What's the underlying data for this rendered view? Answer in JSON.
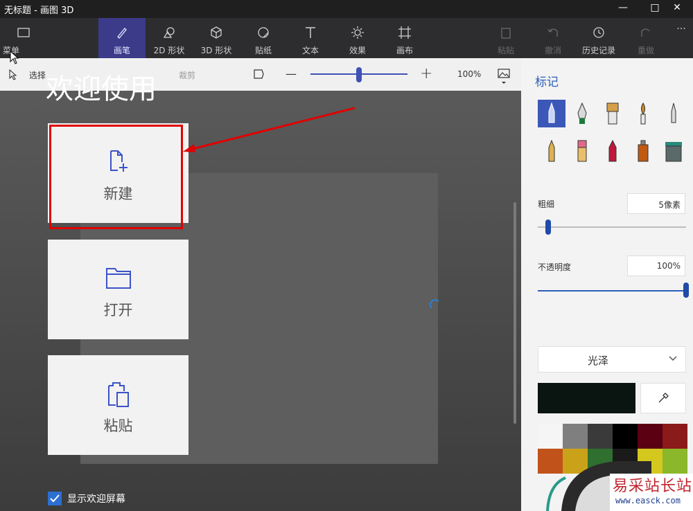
{
  "window": {
    "title": "无标题 - 画图 3D",
    "minimize": "—",
    "maximize": "□",
    "close": "✕"
  },
  "ribbon": {
    "menu": "菜单",
    "tabs": [
      {
        "label": "画笔",
        "icon": "brush-icon",
        "active": true
      },
      {
        "label": "2D 形状",
        "icon": "shapes-2d-icon"
      },
      {
        "label": "3D 形状",
        "icon": "cube-icon"
      },
      {
        "label": "贴纸",
        "icon": "sticker-icon"
      },
      {
        "label": "文本",
        "icon": "text-icon"
      },
      {
        "label": "效果",
        "icon": "effects-icon"
      },
      {
        "label": "画布",
        "icon": "canvas-icon"
      }
    ],
    "actions": [
      {
        "label": "粘贴",
        "icon": "paste-icon",
        "enabled": false
      },
      {
        "label": "撤消",
        "icon": "undo-icon",
        "enabled": false
      },
      {
        "label": "历史记录",
        "icon": "history-icon",
        "enabled": true
      },
      {
        "label": "重做",
        "icon": "redo-icon",
        "enabled": false
      }
    ],
    "more": "···"
  },
  "toolbar": {
    "select": "选择",
    "crop": "裁剪",
    "zoom_minus": "—",
    "zoom_plus": "+",
    "zoom_level": "100%",
    "zoom_fraction": 0.5
  },
  "welcome": {
    "title": "欢迎使用",
    "cards": [
      {
        "label": "新建",
        "icon": "new-file-icon"
      },
      {
        "label": "打开",
        "icon": "folder-icon"
      },
      {
        "label": "粘贴",
        "icon": "paste-icon"
      }
    ],
    "show_welcome_label": "显示欢迎屏幕",
    "show_welcome_checked": true
  },
  "panel": {
    "title": "标记",
    "tools": [
      "marker-icon",
      "calligraphy-pen-icon",
      "oil-brush-icon",
      "watercolor-icon",
      "pixel-pen-icon",
      "pencil-icon",
      "eraser-icon",
      "crayon-icon",
      "spray-can-icon",
      "fill-icon"
    ],
    "thickness_label": "粗细",
    "thickness_value": "5像素",
    "thickness_fraction": 0.05,
    "opacity_label": "不透明度",
    "opacity_value": "100%",
    "opacity_fraction": 1.0,
    "finish_label": "光泽",
    "selected_color": "#0a1410",
    "palette": [
      "#f5f5f5",
      "#7f7f7f",
      "#3a3a3a",
      "#000000",
      "#5a0012",
      "#8b1a1a",
      "#c0521a",
      "#caa21a",
      "#2f6f2f",
      "#1a1a1a",
      "#d4c81e",
      "#8ab82a"
    ]
  },
  "watermark": {
    "line1": "易采站长站",
    "line2": "www.easck.com"
  }
}
